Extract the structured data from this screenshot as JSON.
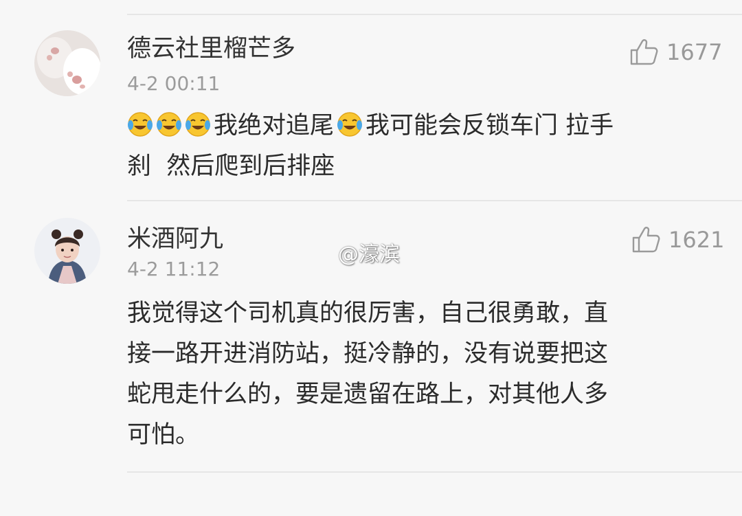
{
  "comments": [
    {
      "username": "德云社里榴芒多",
      "time": "4-2 00:11",
      "likes": "1677",
      "text_line1": "我绝对追尾",
      "text_line2": "我可能会反锁车门 拉手",
      "text_line3": "刹  然后爬到后排座"
    },
    {
      "username": "米酒阿九",
      "time": "4-2 11:12",
      "likes": "1621",
      "text_lines": [
        "我觉得这个司机真的很厉害，自己很勇敢，直",
        "接一路开进消防站，挺冷静的，没有说要把这",
        "蛇甩走什么的，要是遗留在路上，对其他人多",
        "可怕。"
      ]
    }
  ],
  "watermark": "@濠滨",
  "icons": {
    "like": "thumbs-up-icon",
    "emoji": "laughing-crying-emoji-icon"
  }
}
